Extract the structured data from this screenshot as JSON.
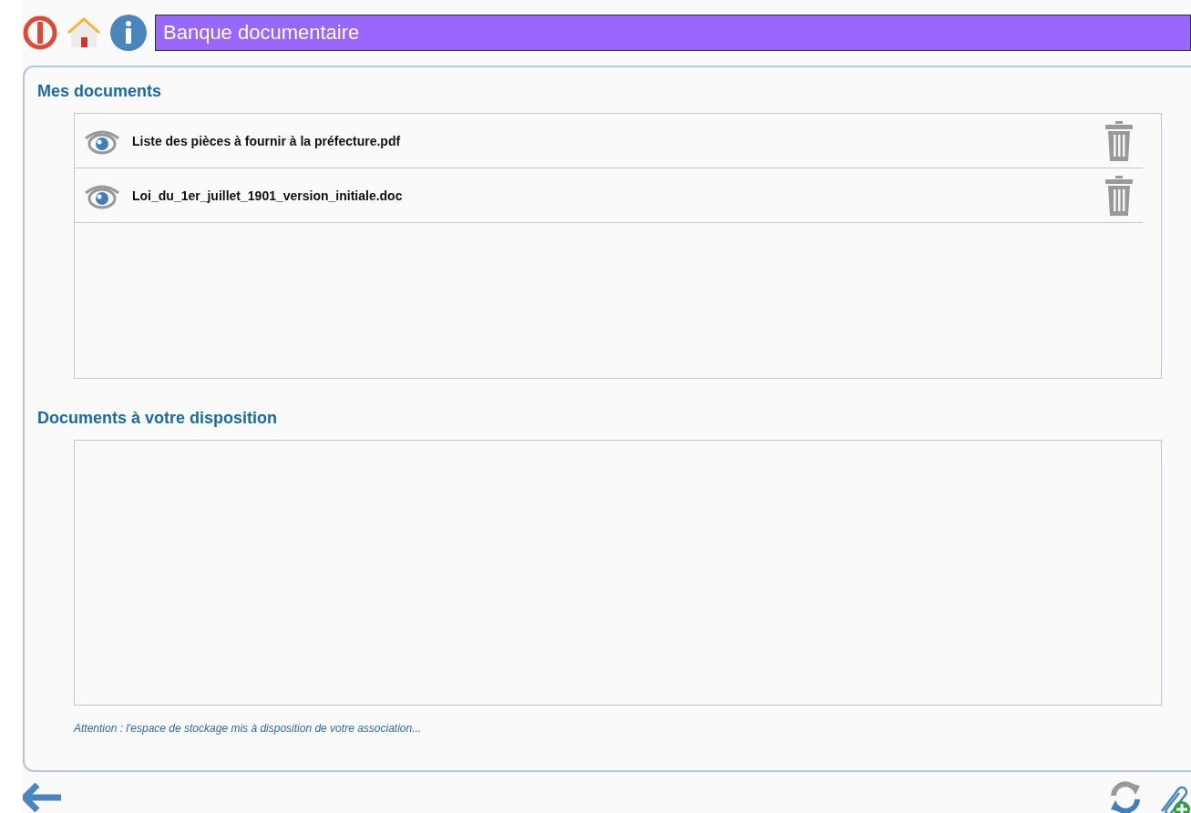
{
  "header": {
    "title": "Banque documentaire"
  },
  "sections": [
    {
      "title": "Mes documents",
      "documents": [
        {
          "name": "Liste des pièces à fournir à la préfecture.pdf"
        },
        {
          "name": "Loi_du_1er_juillet_1901_version_initiale.doc"
        }
      ]
    },
    {
      "title": "Documents à votre disposition"
    }
  ],
  "note": "Attention : l'espace de stockage mis à disposition de votre association..."
}
